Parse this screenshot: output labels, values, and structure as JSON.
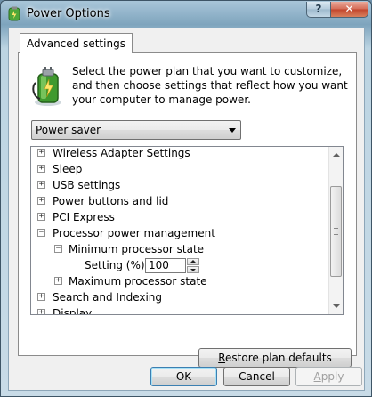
{
  "window": {
    "title": "Power Options",
    "help_glyph": "?",
    "close_glyph": "✕",
    "icon": "power-options-icon"
  },
  "tab": {
    "label": "Advanced settings"
  },
  "intro_text": "Select the power plan that you want to customize, and then choose settings that reflect how you want your computer to manage power.",
  "plan_select": {
    "selected": "Power saver"
  },
  "tree": {
    "expand_glyph": "+",
    "collapse_glyph": "−",
    "items": [
      {
        "label": "Wireless Adapter Settings",
        "state": "collapsed"
      },
      {
        "label": "Sleep",
        "state": "collapsed"
      },
      {
        "label": "USB settings",
        "state": "collapsed"
      },
      {
        "label": "Power buttons and lid",
        "state": "collapsed"
      },
      {
        "label": "PCI Express",
        "state": "collapsed"
      },
      {
        "label": "Processor power management",
        "state": "expanded"
      },
      {
        "label": "Minimum processor state",
        "state": "expanded"
      },
      {
        "label": "Maximum processor state",
        "state": "collapsed"
      },
      {
        "label": "Search and Indexing",
        "state": "collapsed"
      },
      {
        "label": "Display",
        "state": "collapsed"
      }
    ],
    "setting": {
      "label": "Setting (%):",
      "value": "100"
    }
  },
  "buttons": {
    "restore": {
      "underlined": "R",
      "rest": "estore plan defaults"
    },
    "ok": "OK",
    "cancel": "Cancel",
    "apply": {
      "underlined": "A",
      "rest": "pply"
    }
  },
  "colors": {
    "title_bar": "#7ea4bd",
    "close_button": "#c2452c",
    "focus_border": "#3c7fb1",
    "disabled_text": "#a0a0a0"
  }
}
